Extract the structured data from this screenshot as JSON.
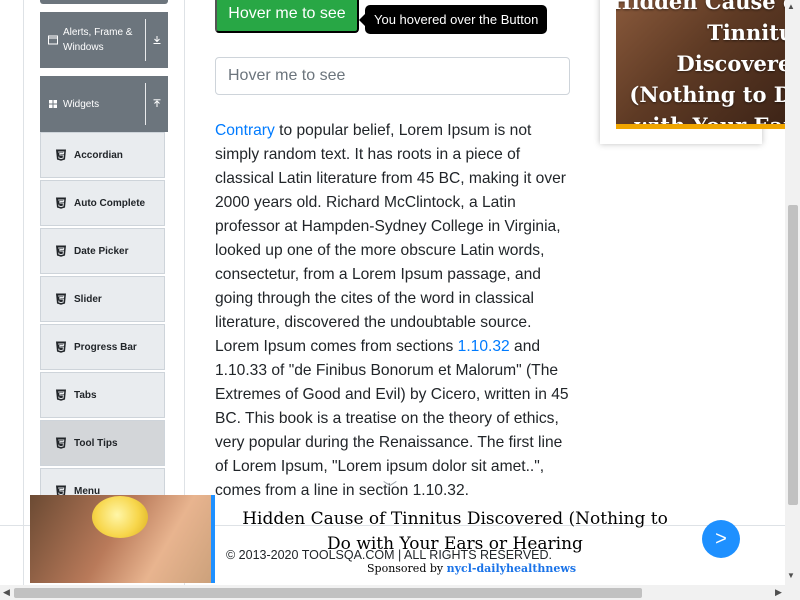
{
  "sidebar": {
    "groups": [
      {
        "label": "Alerts, Frame & Windows",
        "icon": "window-icon",
        "toggle": "download-arrow-icon"
      },
      {
        "label": "Widgets",
        "icon": "grid-icon",
        "toggle": "upload-arrow-icon"
      }
    ],
    "items": [
      {
        "label": "Accordian"
      },
      {
        "label": "Auto Complete"
      },
      {
        "label": "Date Picker"
      },
      {
        "label": "Slider"
      },
      {
        "label": "Progress Bar"
      },
      {
        "label": "Tabs"
      },
      {
        "label": "Tool Tips",
        "active": true
      },
      {
        "label": "Menu"
      }
    ]
  },
  "main": {
    "button_label": "Hover me to see",
    "tooltip_text": "You hovered over the Button",
    "input_placeholder": "Hover me to see",
    "paragraph": {
      "link1": "Contrary",
      "text1": " to popular belief, Lorem Ipsum is not simply random text. It has roots in a piece of classical Latin literature from 45 BC, making it over 2000 years old. Richard McClintock, a Latin professor at Hampden-Sydney College in Virginia, looked up one of the more obscure Latin words, consectetur, from a Lorem Ipsum passage, and going through the cites of the word in classical literature, discovered the undoubtable source. Lorem Ipsum comes from sections ",
      "link2": "1.10.32",
      "text2": " and 1.10.33 of \"de Finibus Bonorum et Malorum\" (The Extremes of Good and Evil) by Cicero, written in 45 BC. This book is a treatise on the theory of ethics, very popular during the Renaissance. The first line of Lorem Ipsum, \"Lorem ipsum dolor sit amet..\", comes from a line in section 1.10.32."
    }
  },
  "right_ad": {
    "headline": "Hidden Cause of Tinnitus Discovered (Nothing to Do with Your Ears or Hearing"
  },
  "footer": {
    "text": "© 2013-2020 TOOLSQA.COM | ALL RIGHTS RESERVED."
  },
  "bottom_ad": {
    "title": "Hidden Cause of Tinnitus Discovered (Nothing to Do with Your Ears or Hearing",
    "sponsored_prefix": "Sponsored by",
    "source": "nycl-dailyhealthnews",
    "next_label": ">"
  },
  "colors": {
    "accent_green": "#28a745",
    "link_blue": "#007bff",
    "sidebar_group": "#6c757d",
    "ad_blue": "#1e90ff"
  }
}
